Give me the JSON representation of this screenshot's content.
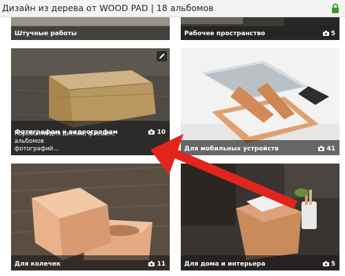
{
  "header": {
    "title": "Дизайн из дерева от WOOD PAD | 18 альбомов"
  },
  "albums": [
    {
      "title": "Штучные работы",
      "count": ""
    },
    {
      "title": "Рабочее пространство",
      "count": "5"
    },
    {
      "title": "Фотографам и видеографам",
      "count": "10",
      "description": "Коробочки для дисков, флешек, альбомов\nфотографий..."
    },
    {
      "title": "Для мобильных устройств",
      "count": "41"
    },
    {
      "title": "Для колечек",
      "count": "11"
    },
    {
      "title": "Для дома и интерьера",
      "count": "5"
    }
  ],
  "colors": {
    "arrow": "#e2251c",
    "lock": "#3a9b1c",
    "caption_bg": "#191919"
  },
  "icons": {
    "lock": "lock-icon",
    "camera": "camera-icon",
    "edit": "pencil-icon"
  }
}
